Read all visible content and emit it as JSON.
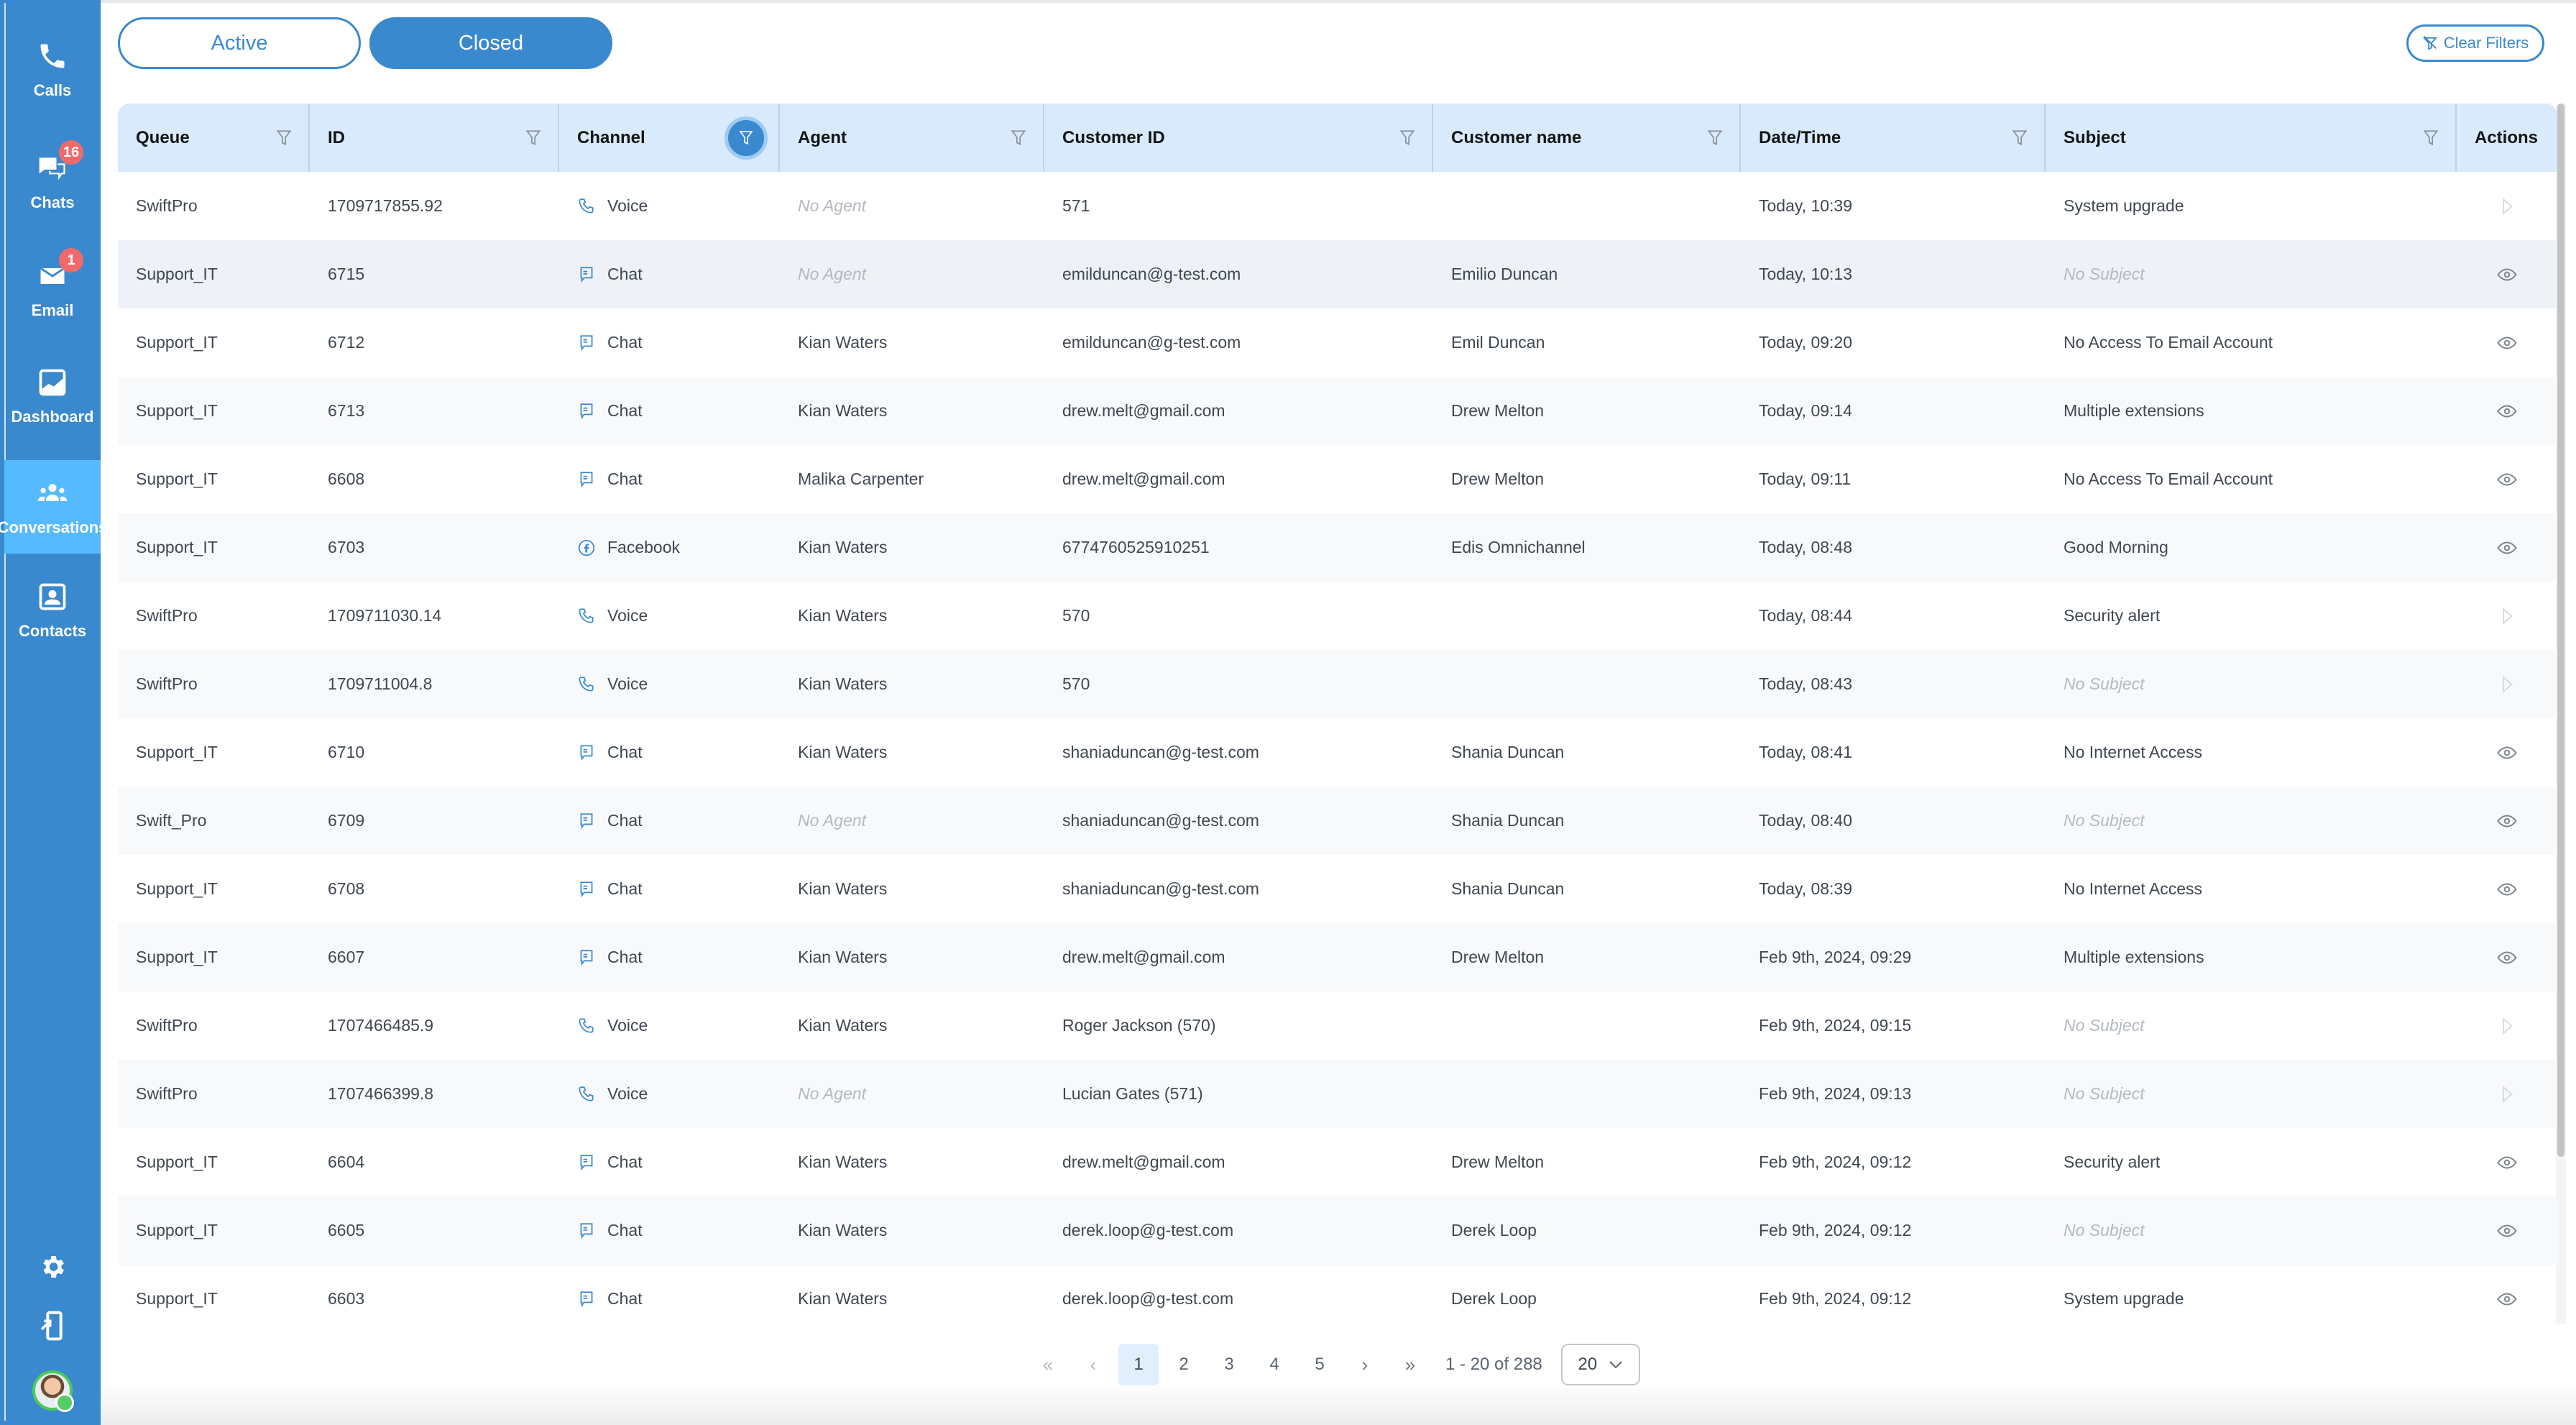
{
  "sidebar": {
    "items": [
      {
        "label": "Calls",
        "icon": "phone-icon",
        "badge": null
      },
      {
        "label": "Chats",
        "icon": "chat-icon",
        "badge": "16"
      },
      {
        "label": "Email",
        "icon": "envelope-icon",
        "badge": "1"
      },
      {
        "label": "Dashboard",
        "icon": "chart-icon",
        "badge": null
      },
      {
        "label": "Conversations",
        "icon": "people-icon",
        "badge": null,
        "active": true
      },
      {
        "label": "Contacts",
        "icon": "contact-card-icon",
        "badge": null
      }
    ],
    "bottom": [
      "gear-icon",
      "logout-device-icon",
      "avatar"
    ]
  },
  "toolbar": {
    "active_label": "Active",
    "closed_label": "Closed",
    "clear_filters_label": "Clear Filters"
  },
  "table": {
    "columns": [
      "Queue",
      "ID",
      "Channel",
      "Agent",
      "Customer ID",
      "Customer name",
      "Date/Time",
      "Subject",
      "Actions"
    ],
    "active_filter_column": "Channel",
    "rows": [
      {
        "queue": "SwiftPro",
        "id": "1709717855.92",
        "channel": "Voice",
        "agent": "No Agent",
        "customer_id": "571",
        "customer_name": "",
        "datetime": "Today, 10:39",
        "subject": "System upgrade",
        "action": "play"
      },
      {
        "queue": "Support_IT",
        "id": "6715",
        "channel": "Chat",
        "agent": "No Agent",
        "customer_id": "emilduncan@g-test.com",
        "customer_name": "Emilio Duncan",
        "datetime": "Today, 10:13",
        "subject": "No Subject",
        "action": "view"
      },
      {
        "queue": "Support_IT",
        "id": "6712",
        "channel": "Chat",
        "agent": "Kian Waters",
        "customer_id": "emilduncan@g-test.com",
        "customer_name": "Emil Duncan",
        "datetime": "Today, 09:20",
        "subject": "No Access To Email Account",
        "action": "view"
      },
      {
        "queue": "Support_IT",
        "id": "6713",
        "channel": "Chat",
        "agent": "Kian Waters",
        "customer_id": "drew.melt@gmail.com",
        "customer_name": "Drew Melton",
        "datetime": "Today, 09:14",
        "subject": "Multiple extensions",
        "action": "view"
      },
      {
        "queue": "Support_IT",
        "id": "6608",
        "channel": "Chat",
        "agent": "Malika Carpenter",
        "customer_id": "drew.melt@gmail.com",
        "customer_name": "Drew Melton",
        "datetime": "Today, 09:11",
        "subject": "No Access To Email Account",
        "action": "view"
      },
      {
        "queue": "Support_IT",
        "id": "6703",
        "channel": "Facebook",
        "agent": "Kian Waters",
        "customer_id": "6774760525910251",
        "customer_name": "Edis Omnichannel",
        "datetime": "Today, 08:48",
        "subject": "Good Morning",
        "action": "view"
      },
      {
        "queue": "SwiftPro",
        "id": "1709711030.14",
        "channel": "Voice",
        "agent": "Kian Waters",
        "customer_id": "570",
        "customer_name": "",
        "datetime": "Today, 08:44",
        "subject": "Security alert",
        "action": "play"
      },
      {
        "queue": "SwiftPro",
        "id": "1709711004.8",
        "channel": "Voice",
        "agent": "Kian Waters",
        "customer_id": "570",
        "customer_name": "",
        "datetime": "Today, 08:43",
        "subject": "No Subject",
        "action": "play"
      },
      {
        "queue": "Support_IT",
        "id": "6710",
        "channel": "Chat",
        "agent": "Kian Waters",
        "customer_id": "shaniaduncan@g-test.com",
        "customer_name": "Shania Duncan",
        "datetime": "Today, 08:41",
        "subject": "No Internet Access",
        "action": "view"
      },
      {
        "queue": "Swift_Pro",
        "id": "6709",
        "channel": "Chat",
        "agent": "No Agent",
        "customer_id": "shaniaduncan@g-test.com",
        "customer_name": "Shania Duncan",
        "datetime": "Today, 08:40",
        "subject": "No Subject",
        "action": "view"
      },
      {
        "queue": "Support_IT",
        "id": "6708",
        "channel": "Chat",
        "agent": "Kian Waters",
        "customer_id": "shaniaduncan@g-test.com",
        "customer_name": "Shania Duncan",
        "datetime": "Today, 08:39",
        "subject": "No Internet Access",
        "action": "view"
      },
      {
        "queue": "Support_IT",
        "id": "6607",
        "channel": "Chat",
        "agent": "Kian Waters",
        "customer_id": "drew.melt@gmail.com",
        "customer_name": "Drew Melton",
        "datetime": "Feb 9th, 2024, 09:29",
        "subject": "Multiple extensions",
        "action": "view"
      },
      {
        "queue": "SwiftPro",
        "id": "1707466485.9",
        "channel": "Voice",
        "agent": "Kian Waters",
        "customer_id": "Roger Jackson (570)",
        "customer_name": "",
        "datetime": "Feb 9th, 2024, 09:15",
        "subject": "No Subject",
        "action": "play"
      },
      {
        "queue": "SwiftPro",
        "id": "1707466399.8",
        "channel": "Voice",
        "agent": "No Agent",
        "customer_id": "Lucian Gates (571)",
        "customer_name": "",
        "datetime": "Feb 9th, 2024, 09:13",
        "subject": "No Subject",
        "action": "play"
      },
      {
        "queue": "Support_IT",
        "id": "6604",
        "channel": "Chat",
        "agent": "Kian Waters",
        "customer_id": "drew.melt@gmail.com",
        "customer_name": "Drew Melton",
        "datetime": "Feb 9th, 2024, 09:12",
        "subject": "Security alert",
        "action": "view"
      },
      {
        "queue": "Support_IT",
        "id": "6605",
        "channel": "Chat",
        "agent": "Kian Waters",
        "customer_id": "derek.loop@g-test.com",
        "customer_name": "Derek Loop",
        "datetime": "Feb 9th, 2024, 09:12",
        "subject": "No Subject",
        "action": "view"
      },
      {
        "queue": "Support_IT",
        "id": "6603",
        "channel": "Chat",
        "agent": "Kian Waters",
        "customer_id": "derek.loop@g-test.com",
        "customer_name": "Derek Loop",
        "datetime": "Feb 9th, 2024, 09:12",
        "subject": "System upgrade",
        "action": "view"
      }
    ],
    "placeholders": {
      "agent": "No Agent",
      "subject": "No Subject"
    }
  },
  "pagination": {
    "first": "«",
    "prev": "‹",
    "pages": [
      "1",
      "2",
      "3",
      "4",
      "5"
    ],
    "current_page": "1",
    "next": "›",
    "last": "»",
    "range_text": "1 - 20 of 288",
    "page_size": "20"
  },
  "colors": {
    "brand": "#3a89cf",
    "sidebar_active": "#55baff",
    "header_bg": "#d8eafc",
    "badge": "#f06a6a",
    "online": "#4ccb5a"
  }
}
